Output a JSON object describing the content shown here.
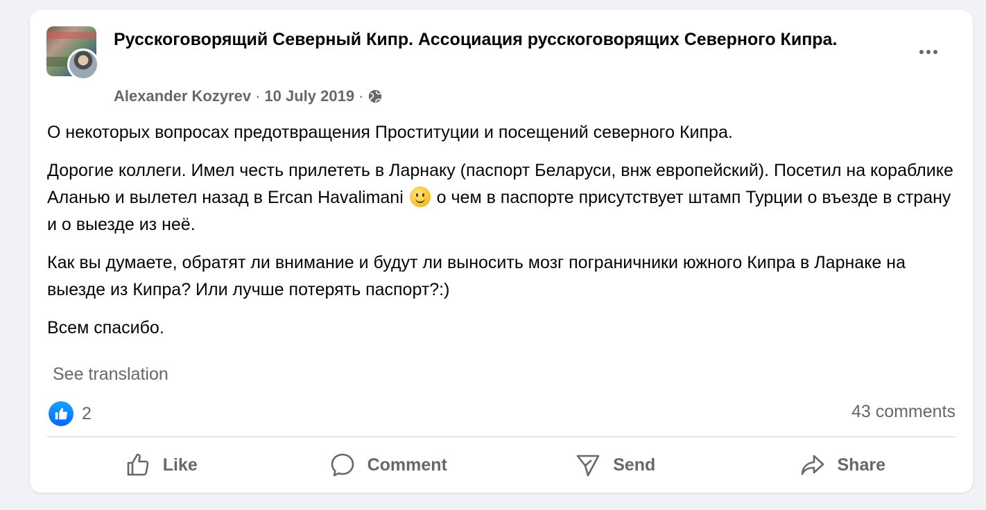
{
  "post": {
    "group_name": "Русскоговорящий Северный Кипр. Ассоциация русскоговорящих Северного Кипра.",
    "author": "Alexander Kozyrev",
    "separator": "·",
    "date": "10 July 2019",
    "privacy_icon": "globe-icon",
    "more_icon": "more-options-icon",
    "paragraphs": {
      "p1": "О некоторых вопросах предотвращения Проституции и посещений северного Кипра.",
      "p2_before_emoji": "Дорогие коллеги. Имел честь прилететь в Ларнаку (паспорт Беларуси, внж европейский). Посетил на кораблике Аланью и вылетел назад в Ercan Havalimani",
      "p2_after_emoji": "о чем в паспорте присутствует штамп Турции о въезде в страну и о выезде из неё.",
      "p3": "Как вы думаете, обратят ли внимание и будут ли выносить мозг пограничники южного Кипра в Ларнаке на выезде из Кипра? Или лучше потерять паспорт?:)",
      "p4": "Всем спасибо."
    },
    "emoji_icon": "slightly-smiling-face-icon",
    "see_translation": "See translation",
    "reaction_count": "2",
    "comments_count": "43 comments"
  },
  "actions": {
    "like": "Like",
    "comment": "Comment",
    "send": "Send",
    "share": "Share"
  },
  "colors": {
    "background": "#f0f2f5",
    "card": "#ffffff",
    "text_primary": "#050505",
    "text_secondary": "#65676b",
    "like_blue": "#0866ff",
    "divider": "#ced0d4"
  }
}
